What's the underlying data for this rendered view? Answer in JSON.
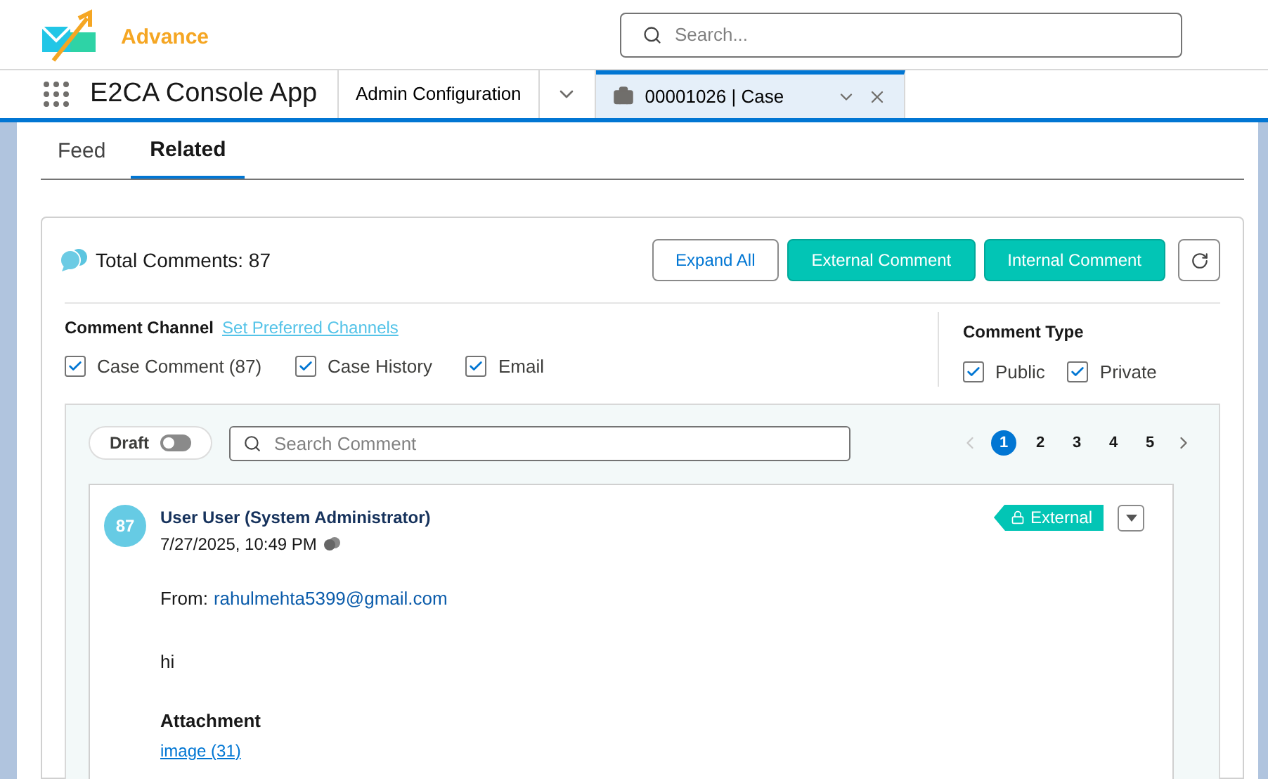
{
  "header": {
    "logo_text": "Advance",
    "search": {
      "placeholder": "Search..."
    }
  },
  "nav": {
    "app_name": "E2CA Console App",
    "tabs": [
      {
        "label": "Admin Configuration",
        "kind": "item",
        "selected": false
      },
      {
        "label": "00001026 | Case",
        "kind": "record",
        "selected": true
      }
    ]
  },
  "subtabs": [
    {
      "label": "Feed",
      "selected": false
    },
    {
      "label": "Related",
      "selected": true
    }
  ],
  "comments_panel": {
    "total": "Total Comments: 87",
    "buttons": [
      {
        "label": "Expand All",
        "kind": "outline"
      },
      {
        "label": "External Comment",
        "kind": "primary"
      },
      {
        "label": "Internal Comment",
        "kind": "primary"
      }
    ],
    "channel": {
      "label": "Comment Channel",
      "link": "Set Preferred Channels",
      "options": [
        {
          "label": "Case Comment (87)",
          "checked": true
        },
        {
          "label": "Case History",
          "checked": true
        },
        {
          "label": "Email",
          "checked": true
        }
      ]
    },
    "type": {
      "label": "Comment Type",
      "options": [
        {
          "label": "Public",
          "checked": true
        },
        {
          "label": "Private",
          "checked": true
        }
      ]
    },
    "draft": {
      "label": "Draft",
      "on": false
    },
    "search": {
      "placeholder": "Search Comment"
    },
    "pages": [
      {
        "label": "1",
        "selected": true
      },
      {
        "label": "2",
        "selected": false
      },
      {
        "label": "3",
        "selected": false
      },
      {
        "label": "4",
        "selected": false
      },
      {
        "label": "5",
        "selected": false
      }
    ],
    "comments": [
      {
        "avatar": "87",
        "author": "User User (System Administrator)",
        "time": "7/27/2025, 10:49 PM",
        "badge": "External",
        "from_label": "From:",
        "from_email": "rahulmehta5399@gmail.com",
        "body": "hi",
        "attachment_label": "Attachment",
        "attachment": "image (31)"
      }
    ]
  }
}
